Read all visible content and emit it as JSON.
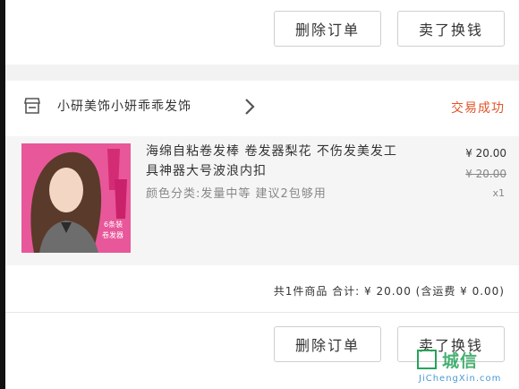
{
  "top_card": {
    "delete_label": "删除订单",
    "sell_label": "卖了换钱"
  },
  "order": {
    "shop_name": "小研美饰小妍乖乖发饰",
    "status": "交易成功",
    "item": {
      "title": "海绵自粘卷发棒 卷发器梨花 不伤发美发工具神器大号波浪内扣",
      "sku": "颜色分类:发量中等 建议2包够用",
      "price": "¥ 20.00",
      "original_price": "¥ 20.00",
      "quantity": "x1",
      "thumb_caption_1": "6条装",
      "thumb_caption_2": "卷发器"
    },
    "summary": "共1件商品 合计: ¥ 20.00 (含运费 ¥ 0.00)",
    "delete_label": "删除订单",
    "sell_label": "卖了换钱"
  },
  "watermark": {
    "text": "城信",
    "url": "JiChengXin.com"
  }
}
